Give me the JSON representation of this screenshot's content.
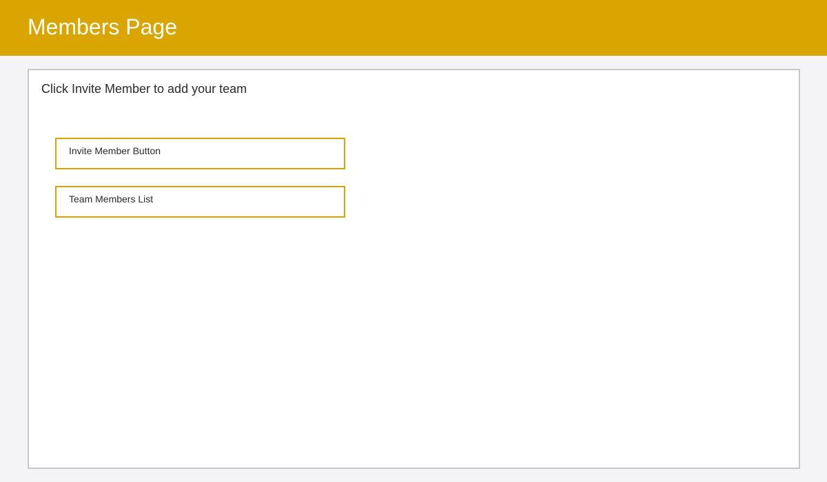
{
  "header": {
    "title": "Members Page"
  },
  "main": {
    "instruction": "Click Invite Member to add your team",
    "invite_box_label": "Invite Member Button",
    "members_box_label": "Team Members List"
  },
  "colors": {
    "accent": "#dba500",
    "page_background": "#f4f4f6",
    "panel_border": "#c8c8cb",
    "text": "#2b2b2b"
  }
}
